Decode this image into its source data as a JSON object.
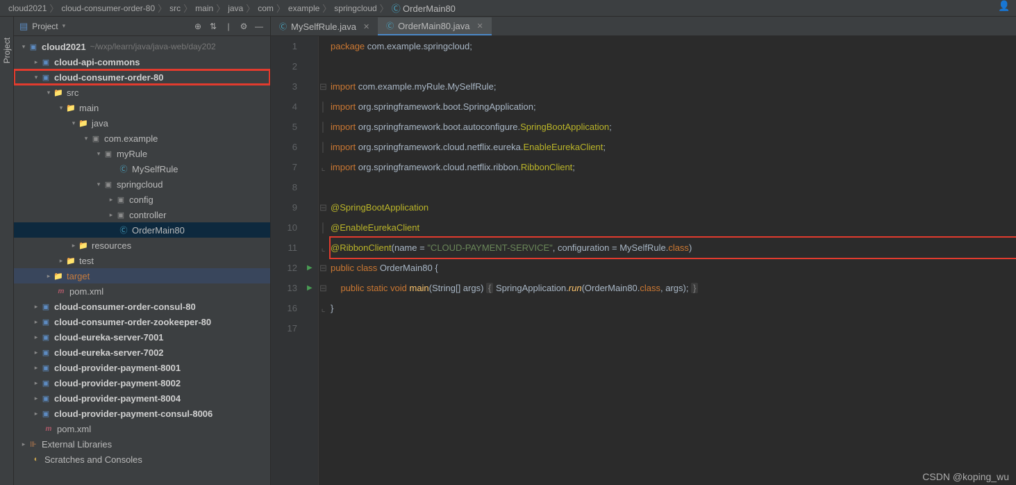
{
  "breadcrumb": [
    "cloud2021",
    "cloud-consumer-order-80",
    "src",
    "main",
    "java",
    "com",
    "example",
    "springcloud"
  ],
  "breadcrumb_file": "OrderMain80",
  "sidebar": {
    "gutter_label": "Project",
    "title": "Project",
    "root": {
      "name": "cloud2021",
      "path": "~/wxp/learn/java/java-web/day202"
    },
    "items": [
      "cloud-api-commons",
      "cloud-consumer-order-80",
      "src",
      "main",
      "java",
      "com.example",
      "myRule",
      "MySelfRule",
      "springcloud",
      "config",
      "controller",
      "OrderMain80",
      "resources",
      "test",
      "target",
      "pom.xml",
      "cloud-consumer-order-consul-80",
      "cloud-consumer-order-zookeeper-80",
      "cloud-eureka-server-7001",
      "cloud-eureka-server-7002",
      "cloud-provider-payment-8001",
      "cloud-provider-payment-8002",
      "cloud-provider-payment-8004",
      "cloud-provider-payment-consul-8006",
      "pom.xml",
      "External Libraries",
      "Scratches and Consoles"
    ]
  },
  "tabs": [
    {
      "label": "MySelfRule.java",
      "active": false
    },
    {
      "label": "OrderMain80.java",
      "active": true
    }
  ],
  "code": {
    "lines": [
      "1",
      "2",
      "3",
      "4",
      "5",
      "6",
      "7",
      "8",
      "9",
      "10",
      "11",
      "12",
      "13",
      "16",
      "17"
    ],
    "l1": {
      "kw": "package",
      "pkg": " com.example.springcloud",
      "sc": ";"
    },
    "l3": {
      "kw": "import",
      "pkg": " com.example.myRule.MySelfRule",
      "sc": ";"
    },
    "l4": {
      "kw": "import",
      "pkg": " org.springframework.boot.SpringApplication",
      "sc": ";"
    },
    "l5": {
      "kw": "import",
      "pkg": " org.springframework.boot.autoconfigure.",
      "cls": "SpringBootApplication",
      "sc": ";"
    },
    "l6": {
      "kw": "import",
      "pkg": " org.springframework.cloud.netflix.eureka.",
      "cls": "EnableEurekaClient",
      "sc": ";"
    },
    "l7": {
      "kw": "import",
      "pkg": " org.springframework.cloud.netflix.ribbon.",
      "cls": "RibbonClient",
      "sc": ";"
    },
    "l9": "@SpringBootApplication",
    "l10": "@EnableEurekaClient",
    "l11": {
      "anno": "@RibbonClient",
      "p1": "(name = ",
      "str": "\"CLOUD-PAYMENT-SERVICE\"",
      "p2": ", configuration = MySelfRule.",
      "kw": "class",
      "p3": ")"
    },
    "l12": {
      "kw1": "public",
      "kw2": "class",
      "name": " OrderMain80 ",
      "brace": "{"
    },
    "l13": {
      "ind": "    ",
      "kw1": "public",
      "kw2": "static",
      "kw3": "void",
      "mth": " main",
      "args": "(String[] args) ",
      "brace": "{",
      "call1": " SpringApplication.",
      "run": "run",
      "call2": "(OrderMain80.",
      "kw4": "class",
      "call3": ", args); ",
      "brace2": "}"
    },
    "l16": "}"
  },
  "watermark": "CSDN @koping_wu"
}
